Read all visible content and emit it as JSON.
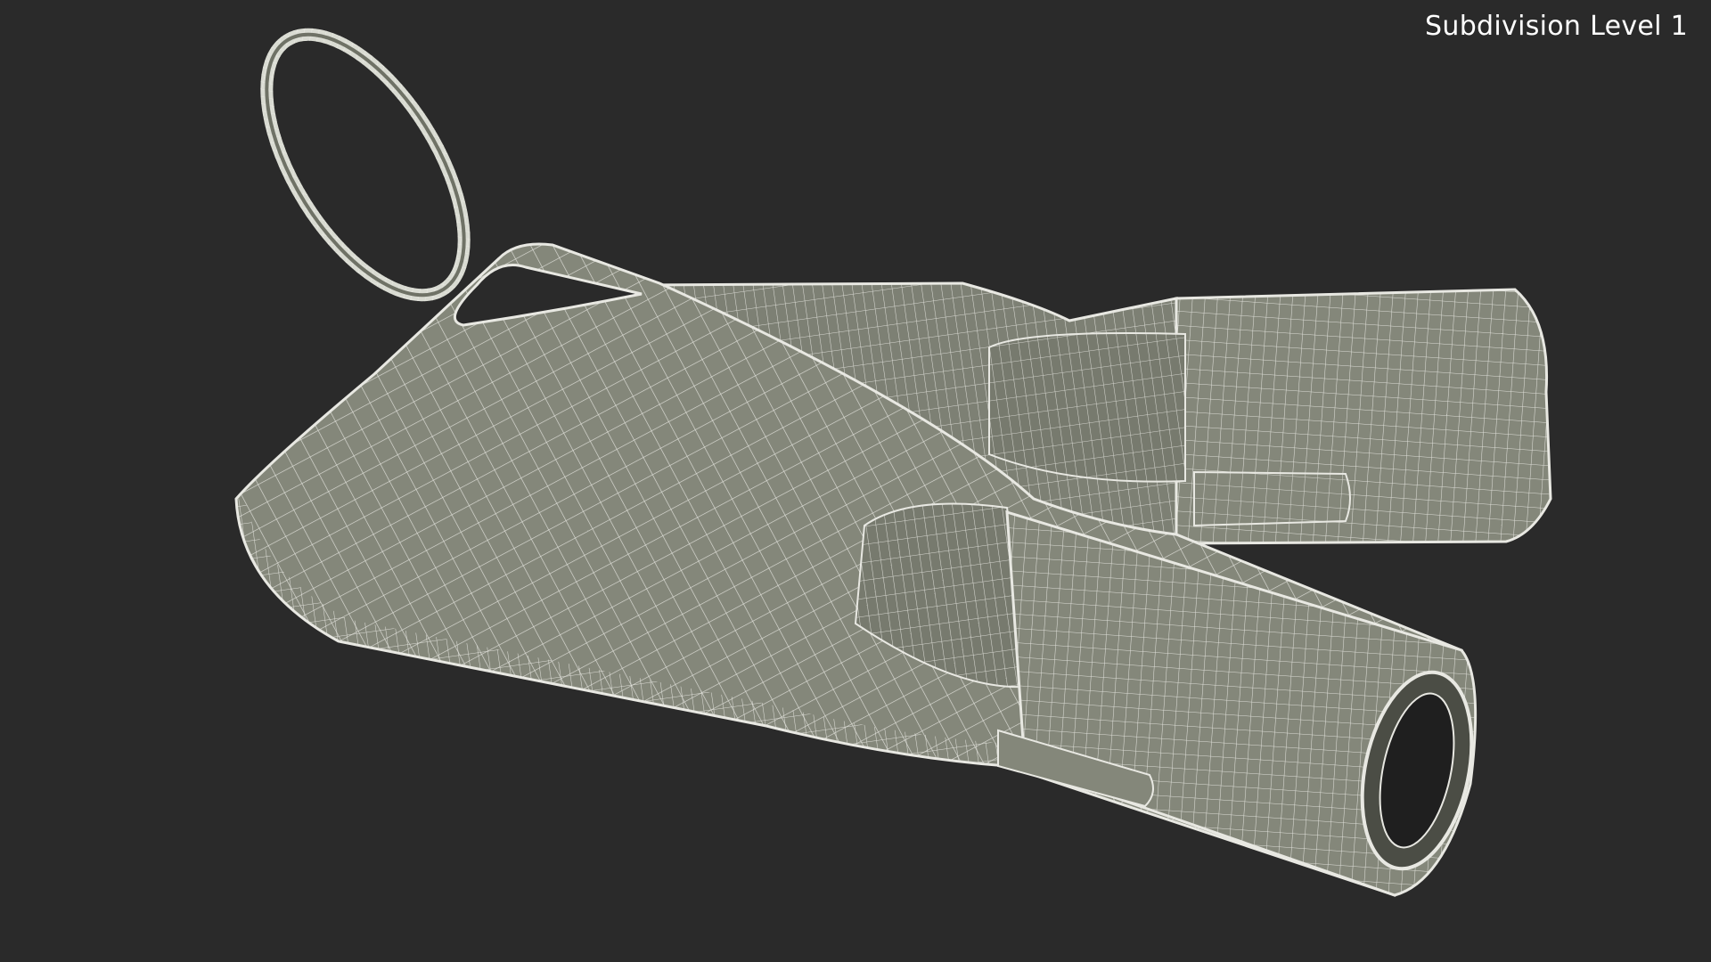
{
  "overlay": {
    "subdivision_label": "Subdivision Level 1"
  },
  "colors": {
    "background": "#2a2a2a",
    "surface": "#84877a",
    "surface_dark": "#6f7266",
    "wire": "#e8e8e2",
    "label": "#ffffff"
  }
}
